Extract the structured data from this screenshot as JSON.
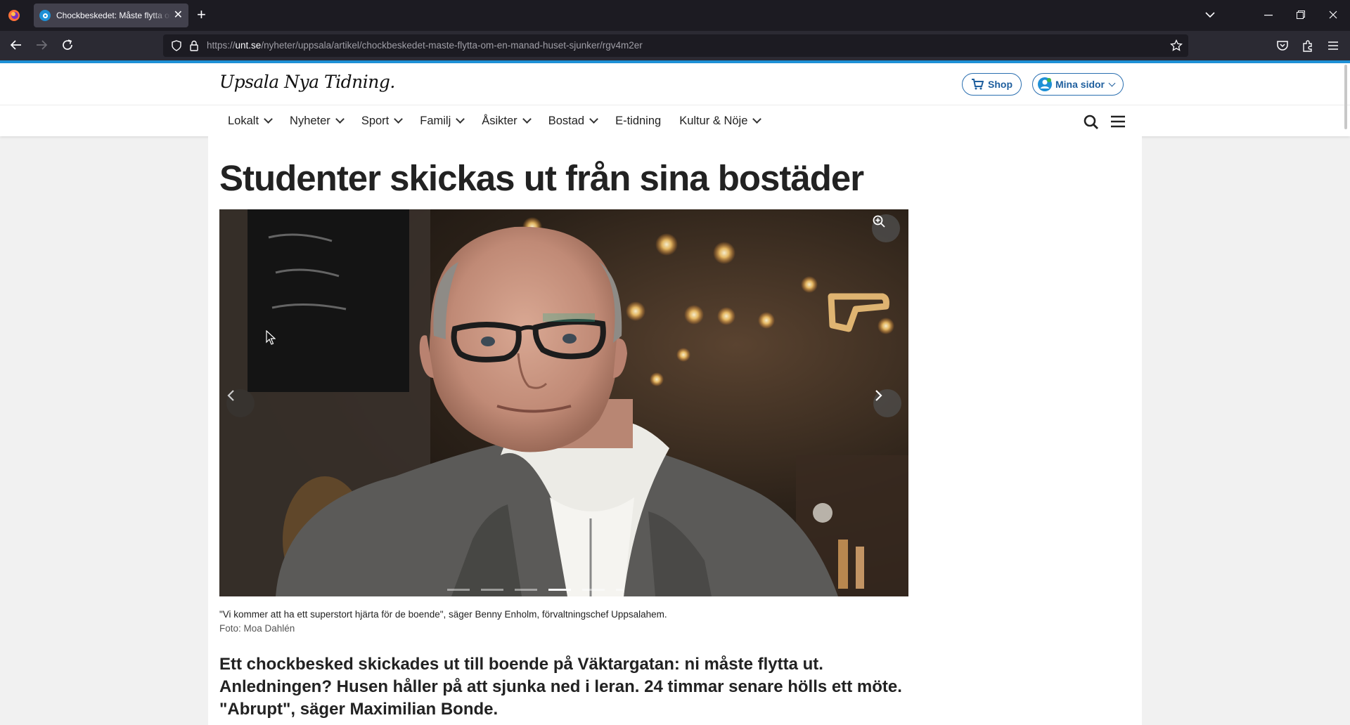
{
  "browser": {
    "tab_title": "Chockbeskedet: Måste flytta om en månad",
    "url_prefix": "https://",
    "url_domain": "unt.se",
    "url_path": "/nyheter/uppsala/artikel/chockbeskedet-maste-flytta-om-en-manad-huset-sjunker/rgv4m2er"
  },
  "site": {
    "logo_text": "Upsala Nya Tidning.",
    "shop_label": "Shop",
    "mina_sidor_label": "Mina sidor",
    "accent_color": "#1e90d6"
  },
  "nav": {
    "items": [
      {
        "label": "Lokalt",
        "has_dropdown": true
      },
      {
        "label": "Nyheter",
        "has_dropdown": true
      },
      {
        "label": "Sport",
        "has_dropdown": true
      },
      {
        "label": "Familj",
        "has_dropdown": true
      },
      {
        "label": "Åsikter",
        "has_dropdown": true
      },
      {
        "label": "Bostad",
        "has_dropdown": true
      },
      {
        "label": "E-tidning",
        "has_dropdown": false
      },
      {
        "label": "Kultur & Nöje",
        "has_dropdown": true
      }
    ]
  },
  "article": {
    "headline": "Studenter skickas ut från sina bostäder",
    "image_caption": "\"Vi kommer att ha ett superstort hjärta för de boende\", säger Benny Enholm, förvaltningschef Uppsalahem.",
    "image_credit": "Foto: Moa Dahlén",
    "lead": "Ett chockbesked skickades ut till boende på Väktargatan: ni måste flytta ut. Anledningen? Husen håller på att sjunka ned i leran. 24 timmar senare hölls ett möte. \"Abrupt\", säger Maximilian Bonde.",
    "gallery_count": 6,
    "gallery_active": 4
  }
}
